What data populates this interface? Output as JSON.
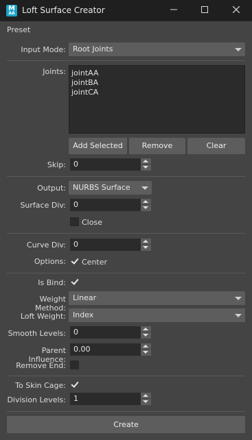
{
  "window": {
    "title": "Loft Surface Creator",
    "icon_letter": "M",
    "icon_sub": "AA"
  },
  "menu": {
    "preset": "Preset"
  },
  "input_mode": {
    "label": "Input Mode:",
    "value": "Root Joints"
  },
  "joints": {
    "label": "Joints:",
    "items": [
      "jointAA",
      "jointBA",
      "jointCA"
    ]
  },
  "buttons": {
    "add_selected": "Add Selected",
    "remove": "Remove",
    "clear": "Clear",
    "create": "Create"
  },
  "skip": {
    "label": "Skip:",
    "value": "0"
  },
  "output": {
    "label": "Output:",
    "value": "NURBS Surface"
  },
  "surface_div": {
    "label": "Surface Div:",
    "value": "0"
  },
  "close": {
    "label": "Close",
    "checked": false
  },
  "curve_div": {
    "label": "Curve Div:",
    "value": "0"
  },
  "options": {
    "label": "Options:",
    "center_label": "Center",
    "center_checked": true
  },
  "is_bind": {
    "label": "Is Bind:",
    "checked": true
  },
  "weight_method": {
    "label": "Weight Method:",
    "value": "Linear"
  },
  "loft_weight": {
    "label": "Loft Weight:",
    "value": "Index"
  },
  "smooth_levels": {
    "label": "Smooth Levels:",
    "value": "0"
  },
  "parent_influence": {
    "label": "Parent Influence:",
    "value": "0.00"
  },
  "remove_end": {
    "label": "Remove End:",
    "checked": false
  },
  "to_skin_cage": {
    "label": "To Skin Cage:",
    "checked": true
  },
  "division_levels": {
    "label": "Division Levels:",
    "value": "1"
  }
}
